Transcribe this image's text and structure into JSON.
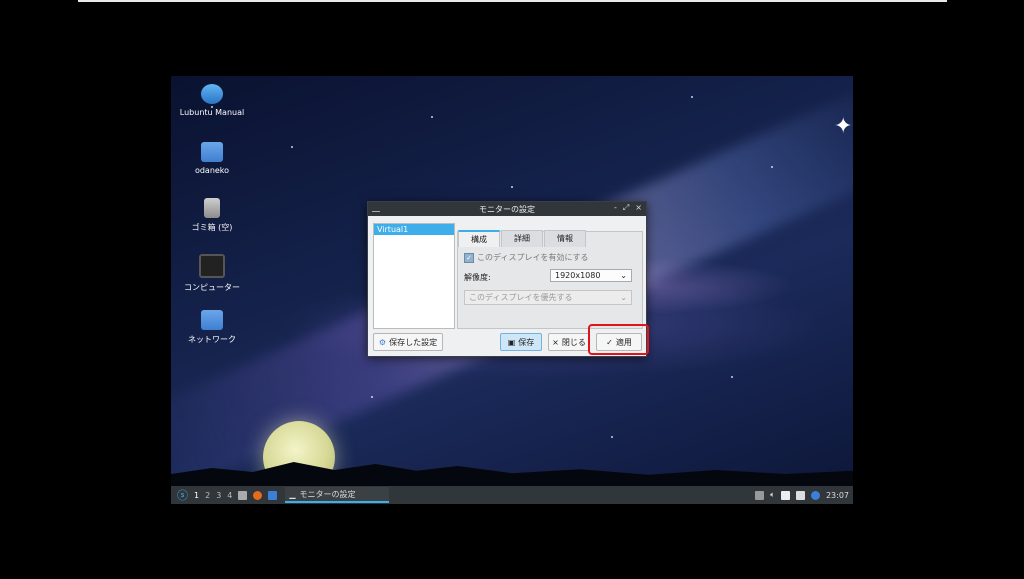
{
  "desktop": {
    "icons": [
      {
        "label": "Lubuntu Manual"
      },
      {
        "label": "odaneko"
      },
      {
        "label": "ゴミ箱 (空)"
      },
      {
        "label": "コンピューター"
      },
      {
        "label": "ネットワーク"
      }
    ]
  },
  "dialog": {
    "title": "モニターの設定",
    "window_buttons": [
      "-",
      "⤢",
      "×"
    ],
    "monitor_list": [
      "Virtual1"
    ],
    "tabs": [
      "構成",
      "詳細",
      "情報"
    ],
    "active_tab": "構成",
    "enable_label": "このディスプレイを有効にする",
    "resolution_label": "解像度:",
    "resolution_value": "1920x1080",
    "primary_label": "このディスプレイを優先する",
    "saved_settings_button": "保存した設定",
    "save_button": "保存",
    "close_button": "閉じる",
    "apply_button": "適用"
  },
  "taskbar": {
    "workspaces": [
      "1",
      "2",
      "3",
      "4"
    ],
    "active_task": "モニターの設定",
    "clock": "23:07"
  },
  "colors": {
    "accent": "#3daee9",
    "highlight": "#e0141e",
    "panel": "#31363b"
  }
}
